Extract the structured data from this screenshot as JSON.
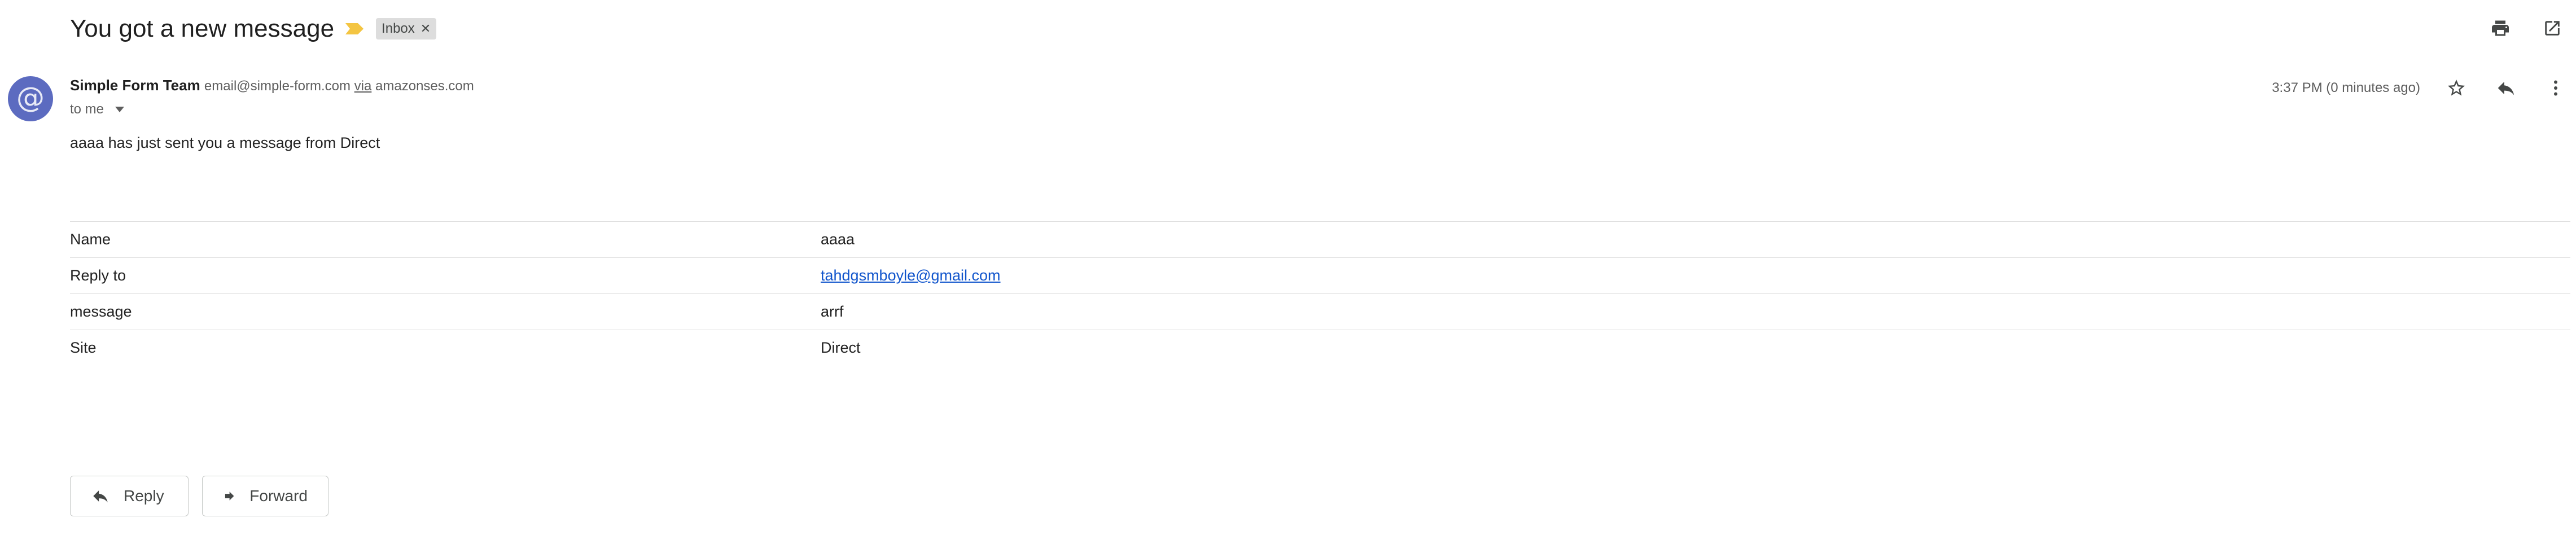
{
  "subject": "You got a new message",
  "label": "Inbox",
  "sender": {
    "name": "Simple Form Team",
    "email": "email@simple-form.com",
    "via_word": "via",
    "via_domain": "amazonses.com",
    "to": "to me"
  },
  "timestamp": "3:37 PM (0 minutes ago)",
  "body": {
    "intro": "aaaa has just sent you a message from Direct",
    "fields": [
      {
        "key": "Name",
        "value": "aaaa"
      },
      {
        "key": "Reply to",
        "value": "tahdgsmboyle@gmail.com"
      },
      {
        "key": "message",
        "value": "arrf"
      },
      {
        "key": "Site",
        "value": "Direct"
      }
    ]
  },
  "actions": {
    "reply": "Reply",
    "forward": "Forward"
  },
  "colors": {
    "avatar": "#5c6bc0",
    "importance": "#f4c542",
    "link": "#1155cc"
  }
}
